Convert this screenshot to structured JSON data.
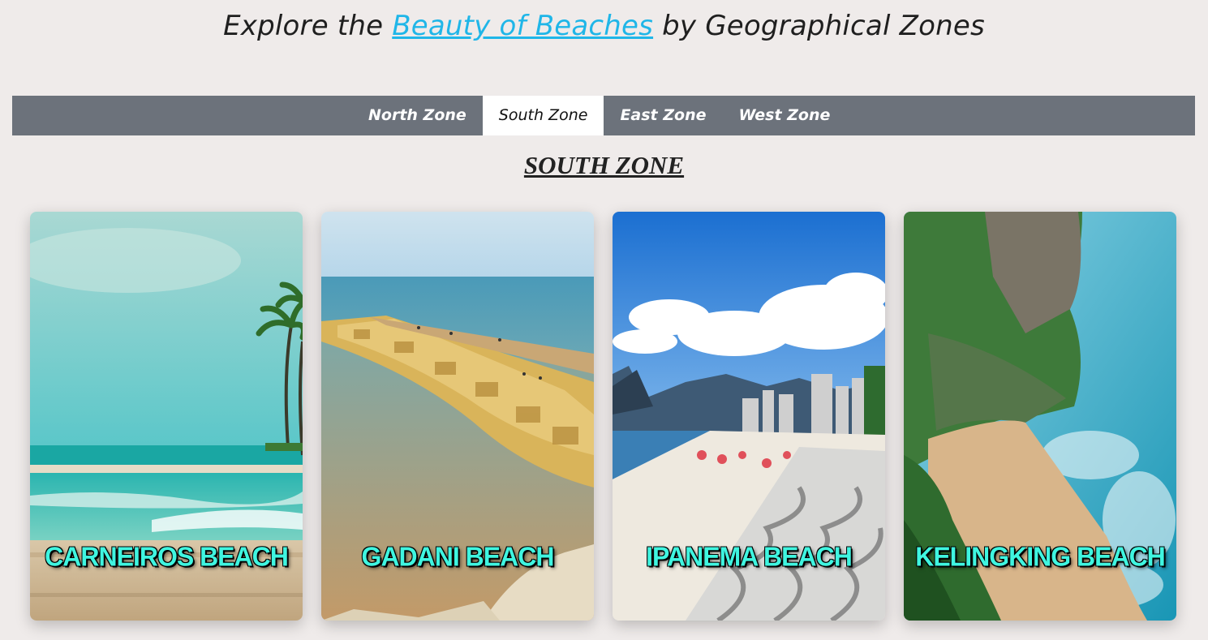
{
  "header": {
    "title_prefix": "Explore the ",
    "title_link": "Beauty of Beaches",
    "title_suffix": " by Geographical Zones"
  },
  "nav": {
    "tabs": [
      {
        "label": "North Zone",
        "active": false
      },
      {
        "label": "South Zone",
        "active": true
      },
      {
        "label": "East Zone",
        "active": false
      },
      {
        "label": "West Zone",
        "active": false
      }
    ]
  },
  "section": {
    "heading": "SOUTH ZONE"
  },
  "cards": [
    {
      "label": "CARNEIROS BEACH"
    },
    {
      "label": "GADANI BEACH"
    },
    {
      "label": "IPANEMA BEACH"
    },
    {
      "label": "KELINGKING BEACH"
    }
  ],
  "colors": {
    "background": "#efebea",
    "navbar": "#6c727b",
    "link": "#1fb6e8",
    "card_label": "#3ff5e0"
  }
}
